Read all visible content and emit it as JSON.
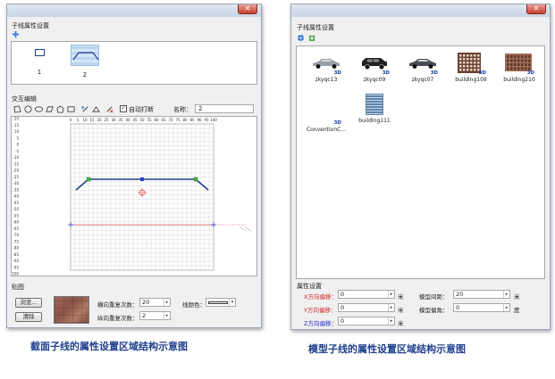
{
  "left": {
    "section_title": "子线属性设置",
    "items": [
      {
        "label": "1"
      },
      {
        "label": "2"
      }
    ],
    "interactive_title": "交互编辑",
    "auto_snap_label": "自动打断",
    "name_label": "名称：",
    "name_value": "2",
    "x_ticks": [
      "0",
      "5",
      "10",
      "15",
      "20",
      "25",
      "30",
      "35",
      "40",
      "45",
      "50",
      "55",
      "60",
      "65",
      "70",
      "75",
      "80",
      "85",
      "90",
      "95",
      "100"
    ],
    "y_ticks": [
      "20",
      "15",
      "10",
      "5",
      "0",
      "-5",
      "-10",
      "-15",
      "-20",
      "-25",
      "-30",
      "-35",
      "-40",
      "-45",
      "-50",
      "-55",
      "-60",
      "-65",
      "-70",
      "-75",
      "-80",
      "-85",
      "-90",
      "-95",
      "-100"
    ],
    "texture_title": "贴图",
    "browse_button": "浏览...",
    "clear_button": "清除",
    "h_repeat_label": "横向重复次数：",
    "h_repeat_value": "20",
    "v_repeat_label": "纵向重复次数：",
    "v_repeat_value": "2",
    "line_color_label": "线颜色：",
    "caption": "截面子线的属性设置区域结构示意图"
  },
  "right": {
    "section_title": "子线属性设置",
    "models": [
      {
        "name": "zkyqc13",
        "tag": "3D"
      },
      {
        "name": "zkyqc09",
        "tag": "3D"
      },
      {
        "name": "zkyqc07",
        "tag": "3D"
      },
      {
        "name": "building109",
        "tag": "3D"
      },
      {
        "name": "building210",
        "tag": "3D"
      },
      {
        "name": "ConventionC...",
        "tag": "3D"
      },
      {
        "name": "building111",
        "tag": ""
      }
    ],
    "attr_title": "属性设置",
    "x_offset_label": "X方向偏移：",
    "x_offset_value": "0",
    "y_offset_label": "Y方向偏移：",
    "y_offset_value": "0",
    "z_offset_label": "Z方向偏移：",
    "z_offset_value": "0",
    "unit_m": "米",
    "unit_deg": "度",
    "spacing_label": "模型间距：",
    "spacing_value": "20",
    "angle_label": "模型偏角：",
    "angle_value": "0",
    "caption": "模型子线的属性设置区域结构示意图"
  },
  "colors": {
    "profile_line": "#1f3f8c",
    "axis_line": "#e05050",
    "caption": "#1f3f8c",
    "offset_label": "#cc2222"
  }
}
